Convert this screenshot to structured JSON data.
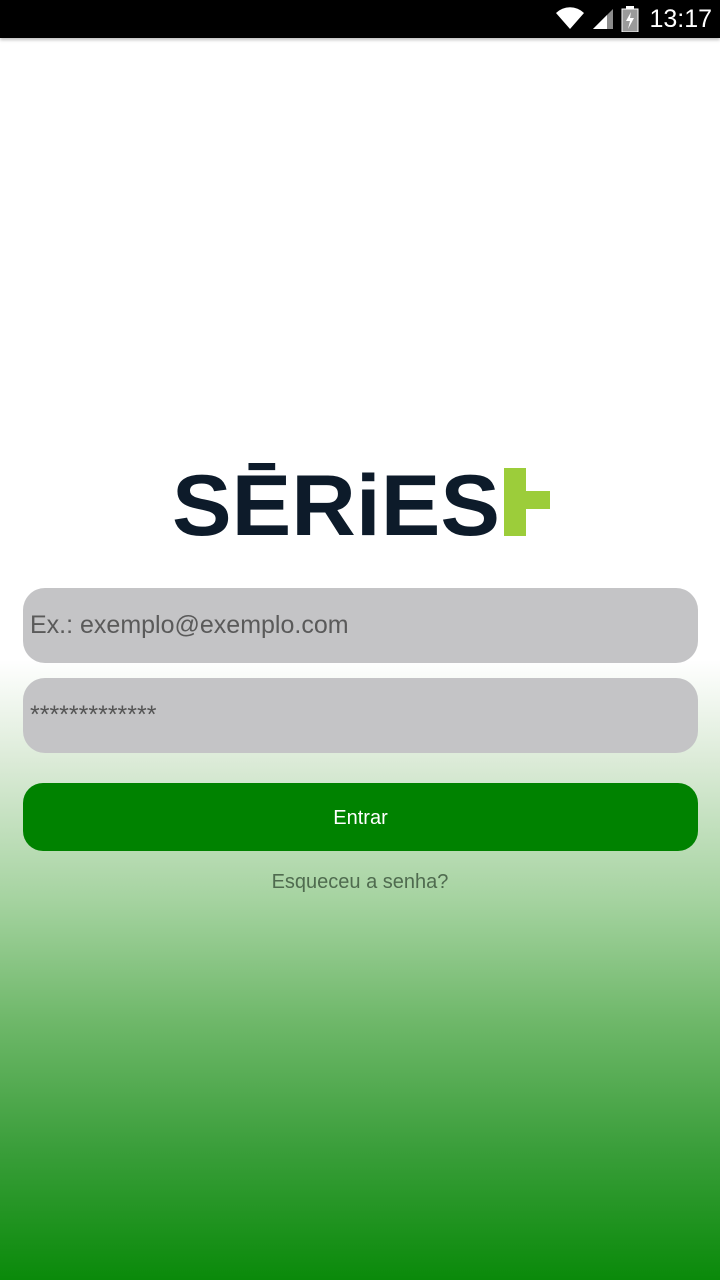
{
  "status_bar": {
    "time": "13:17",
    "icons": [
      "wifi-icon",
      "cell-signal-icon",
      "battery-charging-icon"
    ]
  },
  "logo": {
    "text": "SĒRiES",
    "accent_glyph": "+",
    "colors": {
      "text": "#0d1b2a",
      "accent": "#9ccd3a"
    }
  },
  "login_form": {
    "email_placeholder": "Ex.: exemplo@exemplo.com",
    "email_value": "",
    "password_value": "*************",
    "submit_label": "Entrar",
    "forgot_password_label": "Esqueceu a senha?"
  },
  "colors": {
    "field_background": "#c4c4c6",
    "button_background": "#008200",
    "button_text": "#ffffff",
    "gradient_bottom": "#0a8a0a"
  }
}
